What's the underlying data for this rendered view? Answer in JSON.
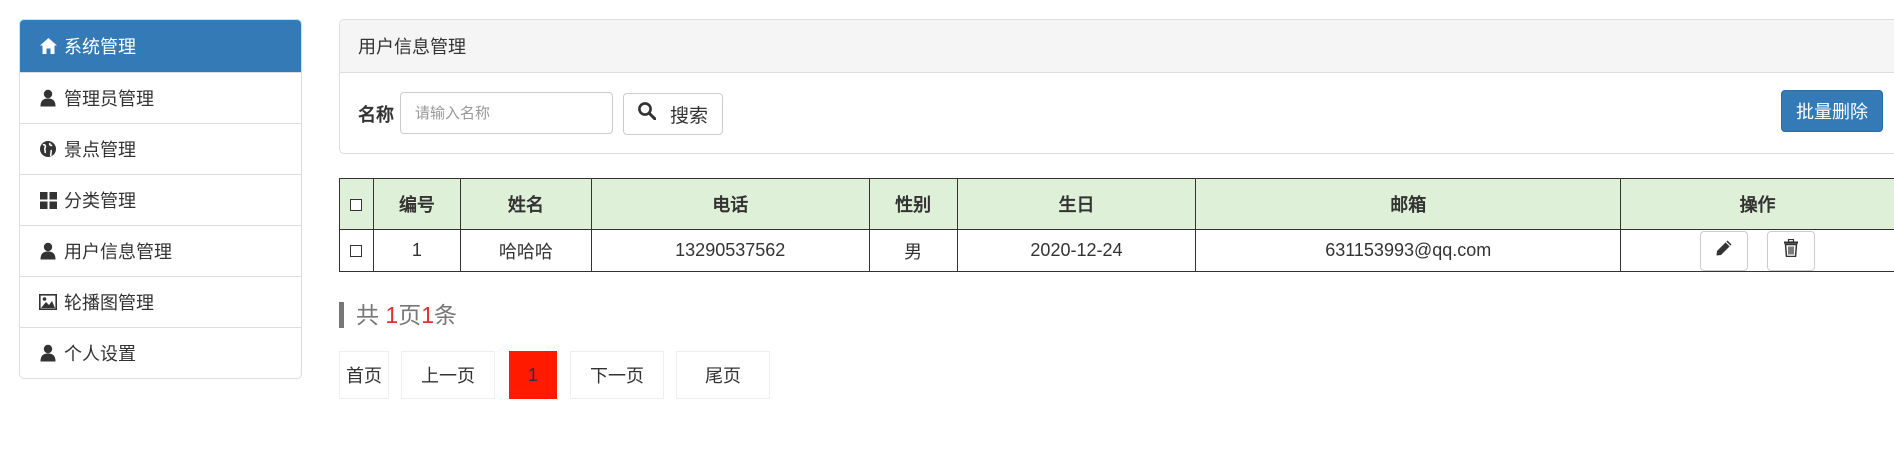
{
  "sidebar": {
    "items": [
      {
        "label": "系统管理",
        "icon": "home-icon",
        "active": true
      },
      {
        "label": "管理员管理",
        "icon": "user-icon"
      },
      {
        "label": "景点管理",
        "icon": "globe-icon"
      },
      {
        "label": "分类管理",
        "icon": "grid-icon"
      },
      {
        "label": "用户信息管理",
        "icon": "user-icon"
      },
      {
        "label": "轮播图管理",
        "icon": "picture-icon"
      },
      {
        "label": "个人设置",
        "icon": "user-icon"
      }
    ],
    "active_color": "#337ab7"
  },
  "panel": {
    "title": "用户信息管理",
    "search": {
      "label": "名称",
      "placeholder": "请输入名称",
      "value": "",
      "button_label": "搜索"
    },
    "batch_delete_label": "批量删除"
  },
  "table": {
    "headers": [
      "编号",
      "姓名",
      "电话",
      "性别",
      "生日",
      "邮箱",
      "操作"
    ],
    "rows": [
      {
        "id": "1",
        "name": "哈哈哈",
        "phone": "13290537562",
        "gender": "男",
        "birthday": "2020-12-24",
        "email": "631153993@qq.com"
      }
    ],
    "header_bg": "#dff0d8"
  },
  "summary": {
    "prefix": "共",
    "pages": "1",
    "page_unit": "页",
    "count": "1",
    "count_unit": "条"
  },
  "pagination": {
    "first": "首页",
    "prev": "上一页",
    "current": "1",
    "next": "下一页",
    "last": "尾页",
    "current_color": "#ff1a00"
  }
}
